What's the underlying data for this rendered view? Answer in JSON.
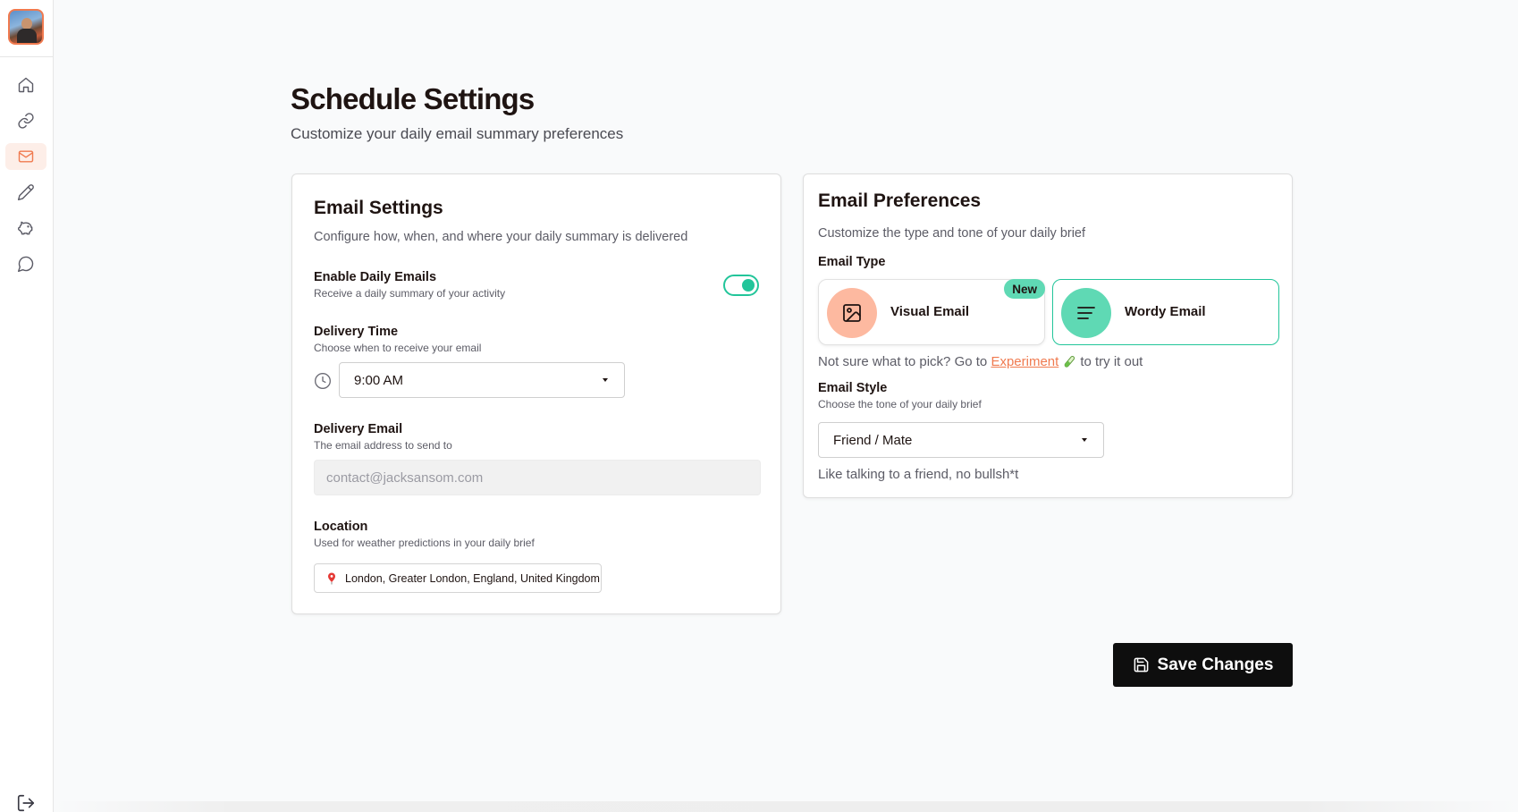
{
  "sidebar": {
    "avatar_icon": "user-avatar",
    "items": [
      {
        "name": "home",
        "icon": "home-icon",
        "active": false
      },
      {
        "name": "links",
        "icon": "link-icon",
        "active": false
      },
      {
        "name": "email",
        "icon": "mail-icon",
        "active": true
      },
      {
        "name": "write",
        "icon": "pencil-icon",
        "active": false
      },
      {
        "name": "savings",
        "icon": "piggy-bank-icon",
        "active": false
      },
      {
        "name": "chat",
        "icon": "chat-icon",
        "active": false
      }
    ],
    "logout_icon": "logout-icon"
  },
  "header": {
    "title": "Schedule Settings",
    "subtitle": "Customize your daily email summary preferences"
  },
  "email_settings": {
    "title": "Email Settings",
    "description": "Configure how, when, and where your daily summary is delivered",
    "enable": {
      "label": "Enable Daily Emails",
      "help": "Receive a daily summary of your activity",
      "enabled": true
    },
    "delivery_time": {
      "label": "Delivery Time",
      "help": "Choose when to receive your email",
      "value": "9:00 AM"
    },
    "delivery_email": {
      "label": "Delivery Email",
      "help": "The email address to send to",
      "placeholder": "contact@jacksansom.com"
    },
    "location": {
      "label": "Location",
      "help": "Used for weather predictions in your daily brief",
      "value": "London, Greater London, England, United Kingdom"
    }
  },
  "email_preferences": {
    "title": "Email Preferences",
    "description": "Customize the type and tone of your daily brief",
    "type_label": "Email Type",
    "types": [
      {
        "label": "Visual Email",
        "icon": "image-icon",
        "badge": "New",
        "selected": false
      },
      {
        "label": "Wordy Email",
        "icon": "text-lines-icon",
        "selected": true
      }
    ],
    "hint_prefix": "Not sure what to pick? Go to",
    "hint_link": "Experiment",
    "hint_suffix": "to try it out",
    "style": {
      "label": "Email Style",
      "help": "Choose the tone of your daily brief",
      "value": "Friend / Mate",
      "description": "Like talking to a friend, no bullsh*t"
    }
  },
  "save_button": {
    "label": "Save Changes",
    "icon": "save-icon"
  },
  "colors": {
    "accent": "#f07a4f",
    "success": "#22c59a",
    "mint": "#5fd9b4",
    "peach": "#fdb9a0"
  }
}
